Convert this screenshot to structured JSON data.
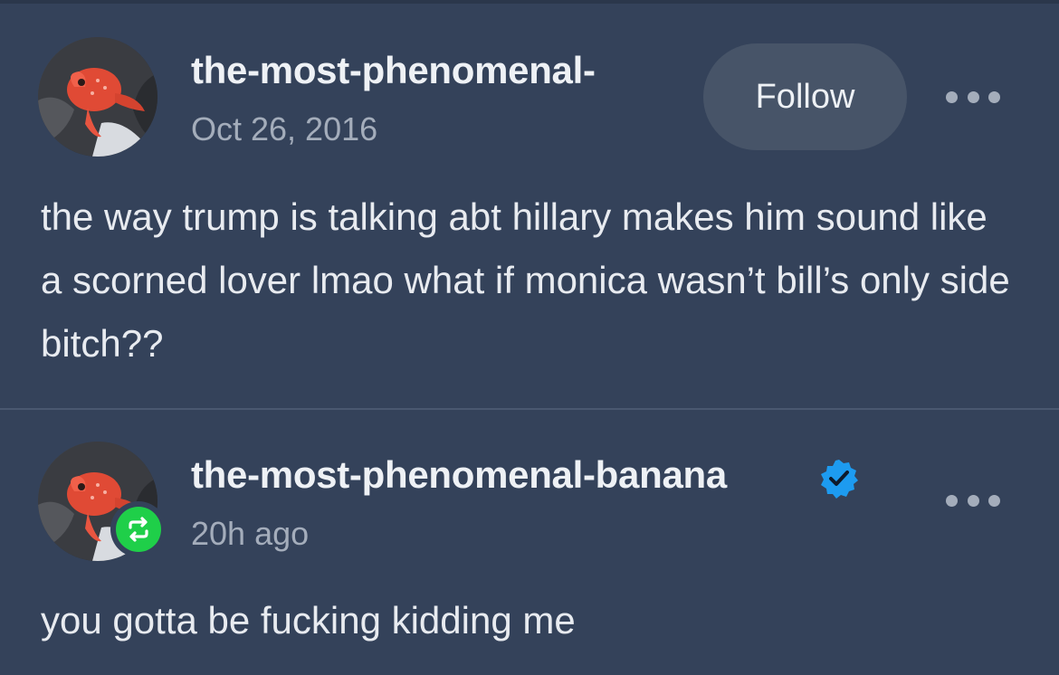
{
  "posts": [
    {
      "username": "the-most-phenomenal-",
      "timestamp": "Oct 26, 2016",
      "follow_label": "Follow",
      "body": "the way trump is talking abt hillary makes him sound like a scorned lover lmao what if monica wasn’t bill’s only side bitch??",
      "avatar_icon": "red-fish-avatar",
      "more_icon": "more-dots-icon"
    },
    {
      "username": "the-most-phenomenal-banana",
      "verified": true,
      "timestamp": "20h ago",
      "body": "you gotta be fucking kidding me",
      "avatar_icon": "red-fish-avatar",
      "badge_icon": "reblog-icon",
      "more_icon": "more-dots-icon"
    }
  ],
  "colors": {
    "background": "#34425a",
    "follow_button": "#475468",
    "reblog_green": "#1fcf49",
    "verified_blue": "#1d9bf0",
    "muted_text": "#a4adbb"
  }
}
